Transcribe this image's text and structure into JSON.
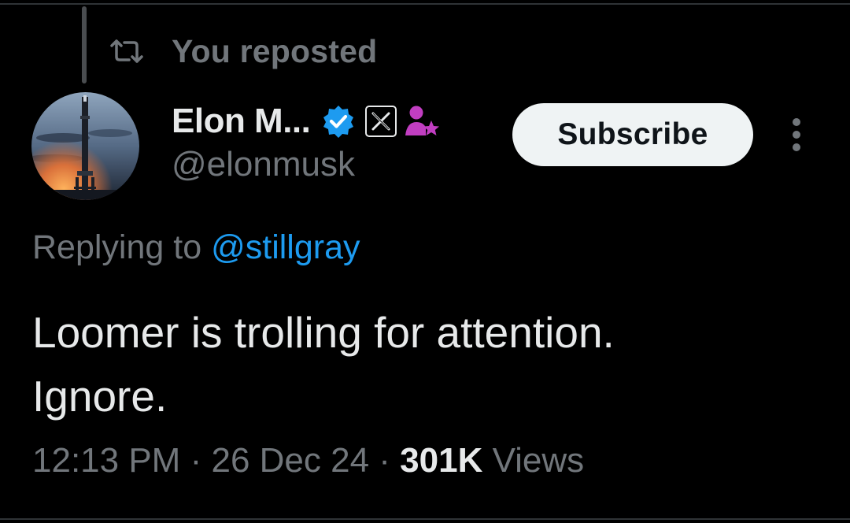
{
  "repost": {
    "icon": "repost-icon",
    "label": "You reposted"
  },
  "author": {
    "avatar": "rocket-launch-avatar",
    "display_name": "Elon M...",
    "handle": "@elonmusk",
    "badges": [
      "verified-badge-icon",
      "x-affiliate-badge-icon",
      "person-star-icon"
    ]
  },
  "actions": {
    "subscribe_label": "Subscribe",
    "more_icon": "more-vertical-icon"
  },
  "reply": {
    "prefix": "Replying to",
    "handle": "@stillgray"
  },
  "tweet": {
    "text": "Loomer is trolling for attention.\nIgnore."
  },
  "meta": {
    "time": "12:13 PM",
    "separator": "·",
    "date": "26 Dec 24",
    "views_count": "301K",
    "views_label": "Views"
  },
  "colors": {
    "background": "#000000",
    "primary_text": "#e7e9ea",
    "secondary_text": "#71767b",
    "link_blue": "#1d9bf0",
    "verified_blue": "#1d9bf0",
    "affiliate_magenta": "#c13ec1",
    "button_bg": "#eff3f4"
  }
}
